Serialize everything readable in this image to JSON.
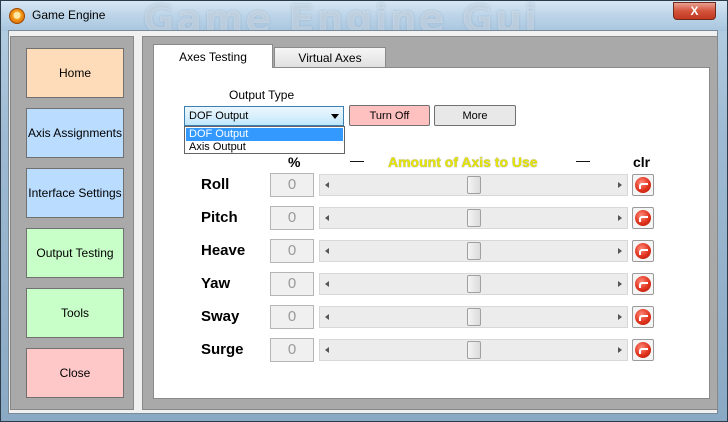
{
  "window": {
    "title": "Game Engine",
    "watermark": "Game Engine Gui",
    "close_label": "X"
  },
  "sidebar": {
    "items": [
      {
        "label": "Home",
        "color": "#ffdcb9"
      },
      {
        "label": "Axis Assignments",
        "color": "#b9dcff"
      },
      {
        "label": "Interface Settings",
        "color": "#b9dcff"
      },
      {
        "label": "Output Testing",
        "color": "#c8ffc8"
      },
      {
        "label": "Tools",
        "color": "#c8ffc8"
      },
      {
        "label": "Close",
        "color": "#ffc8c8"
      }
    ]
  },
  "tabs": [
    {
      "label": "Axes Testing",
      "active": true
    },
    {
      "label": "Virtual Axes",
      "active": false
    }
  ],
  "output": {
    "label": "Output Type",
    "selected": "DOF Output",
    "options": [
      "DOF Output",
      "Axis Output"
    ],
    "turn_off_label": "Turn Off",
    "more_label": "More"
  },
  "header": {
    "percent": "%",
    "dash_left": "—",
    "title": "Amount of Axis to Use",
    "dash_right": "—",
    "clr": "clr"
  },
  "axes": [
    {
      "name": "Roll",
      "percent": "0",
      "slider": 0.5
    },
    {
      "name": "Pitch",
      "percent": "0",
      "slider": 0.5
    },
    {
      "name": "Heave",
      "percent": "0",
      "slider": 0.5
    },
    {
      "name": "Yaw",
      "percent": "0",
      "slider": 0.5
    },
    {
      "name": "Sway",
      "percent": "0",
      "slider": 0.5
    },
    {
      "name": "Surge",
      "percent": "0",
      "slider": 0.5
    }
  ],
  "colors": {
    "turn_off": "#ffc0c0",
    "more": "#e8e8e8",
    "accent": "#3399ff"
  }
}
